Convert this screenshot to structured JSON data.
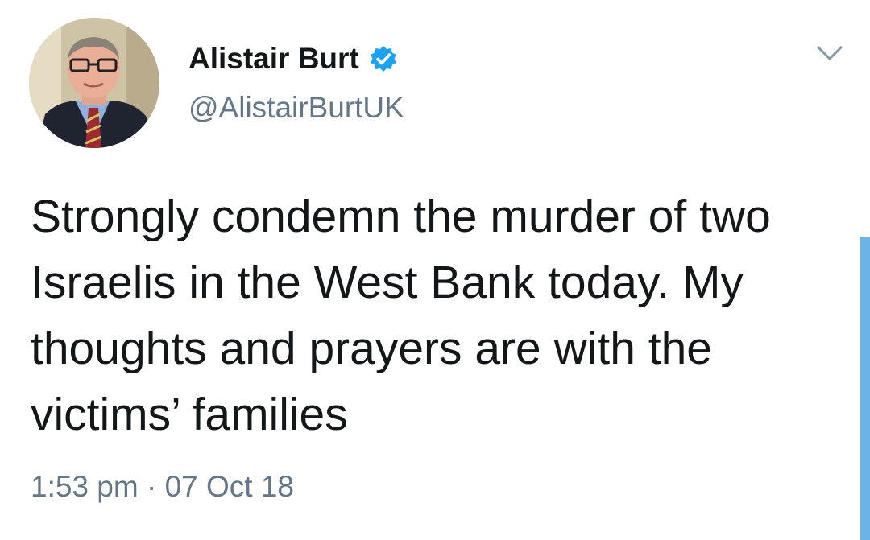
{
  "tweet": {
    "display_name": "Alistair Burt",
    "handle": "@AlistairBurtUK",
    "text": "Strongly condemn the murder of two Israelis in the West Bank today. My thoughts and prayers are with the victims’ families",
    "timestamp": "1:53 pm · 07 Oct 18",
    "verified": true
  },
  "icons": {
    "verified": "verified-badge-icon",
    "caret": "chevron-down-icon"
  },
  "colors": {
    "verified_blue": "#1da1f2",
    "secondary_text": "#657786",
    "primary_text": "#14171a",
    "scrollbar": "#6ab4e8"
  }
}
